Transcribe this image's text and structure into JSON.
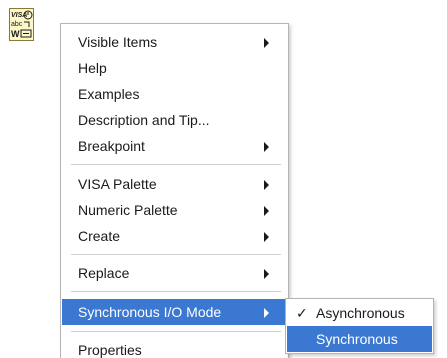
{
  "node": {
    "icon": "visa-write-icon",
    "icon_text_top": "VISA",
    "icon_text_mid": "abc",
    "icon_text_bottom": "W"
  },
  "context_menu": {
    "items": [
      {
        "label": "Visible Items",
        "submenu": true
      },
      {
        "label": "Help",
        "submenu": false
      },
      {
        "label": "Examples",
        "submenu": false
      },
      {
        "label": "Description and Tip...",
        "submenu": false
      },
      {
        "label": "Breakpoint",
        "submenu": true
      },
      {
        "label": "VISA Palette",
        "submenu": true
      },
      {
        "label": "Numeric Palette",
        "submenu": true
      },
      {
        "label": "Create",
        "submenu": true
      },
      {
        "label": "Replace",
        "submenu": true
      },
      {
        "label": "Synchronous I/O Mode",
        "submenu": true,
        "highlighted": true
      },
      {
        "label": "Properties",
        "submenu": false
      }
    ]
  },
  "submenu": {
    "items": [
      {
        "label": "Asynchronous",
        "checked": true,
        "check_glyph": "✓"
      },
      {
        "label": "Synchronous",
        "checked": false,
        "highlighted": true
      }
    ]
  },
  "colors": {
    "highlight": "#3b78d1",
    "icon_background": "#fdf7c8"
  }
}
